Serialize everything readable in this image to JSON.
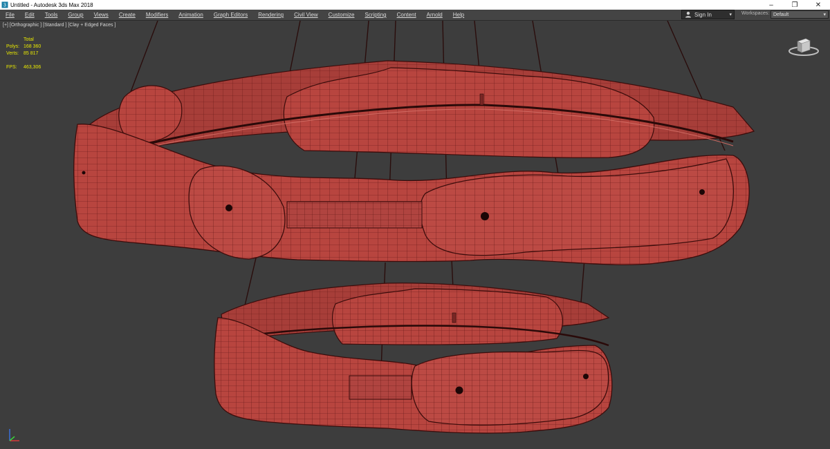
{
  "window": {
    "title": "Untitled - Autodesk 3ds Max 2018",
    "app_icon": "3dsmax-logo-icon",
    "controls": {
      "minimize": "–",
      "restore": "❐",
      "close": "✕"
    }
  },
  "menubar": {
    "items": [
      "File",
      "Edit",
      "Tools",
      "Group",
      "Views",
      "Create",
      "Modifiers",
      "Animation",
      "Graph Editors",
      "Rendering",
      "Civil View",
      "Customize",
      "Scripting",
      "Content",
      "Arnold",
      "Help"
    ],
    "signin": {
      "label": "Sign In",
      "icon": "user-icon",
      "arrow": "▾"
    },
    "workspaces": {
      "label": "Workspaces:",
      "value": "Default",
      "arrow": "▾"
    }
  },
  "viewport": {
    "label": "[+] [Orthographic ] [Standard ] [Clay + Edged Faces ]",
    "stats": {
      "header": "Total",
      "polys_label": "Polys:",
      "polys_value": "168 360",
      "verts_label": "Verts:",
      "verts_value": "85 817",
      "fps_label": "FPS:",
      "fps_value": "463,306"
    },
    "viewcube_icon": "viewcube-icon",
    "axis_icon": "axis-tripod-icon",
    "colors": {
      "background": "#3d3d3d",
      "model": "#b8453f",
      "wire": "#5a1412",
      "stats": "#e8e800"
    }
  }
}
